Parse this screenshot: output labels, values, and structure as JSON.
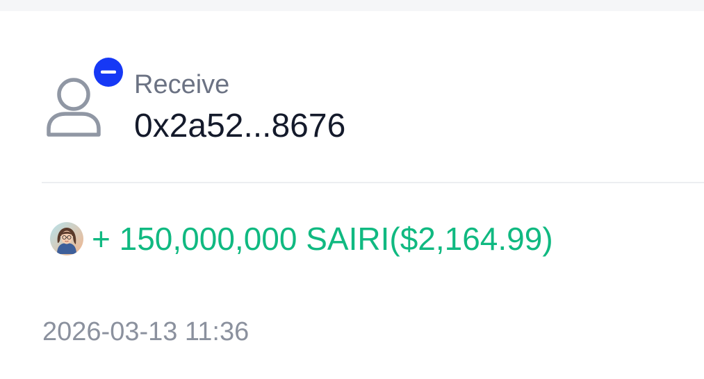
{
  "transaction": {
    "type_label": "Receive",
    "counterparty_address": "0x2a52...8676",
    "amount_text": "+ 150,000,000 SAIRI($2,164.99)",
    "token_symbol": "SAIRI",
    "timestamp": "2026-03-13 11:36"
  },
  "icons": {
    "counterparty": "user-outline-icon",
    "status_badge": "minus-circle-icon",
    "token": "token-avatar-icon"
  },
  "colors": {
    "amount_positive": "#10b981",
    "badge": "#1638f5",
    "label_secondary": "#6b7283",
    "text_primary": "#141a2b"
  }
}
